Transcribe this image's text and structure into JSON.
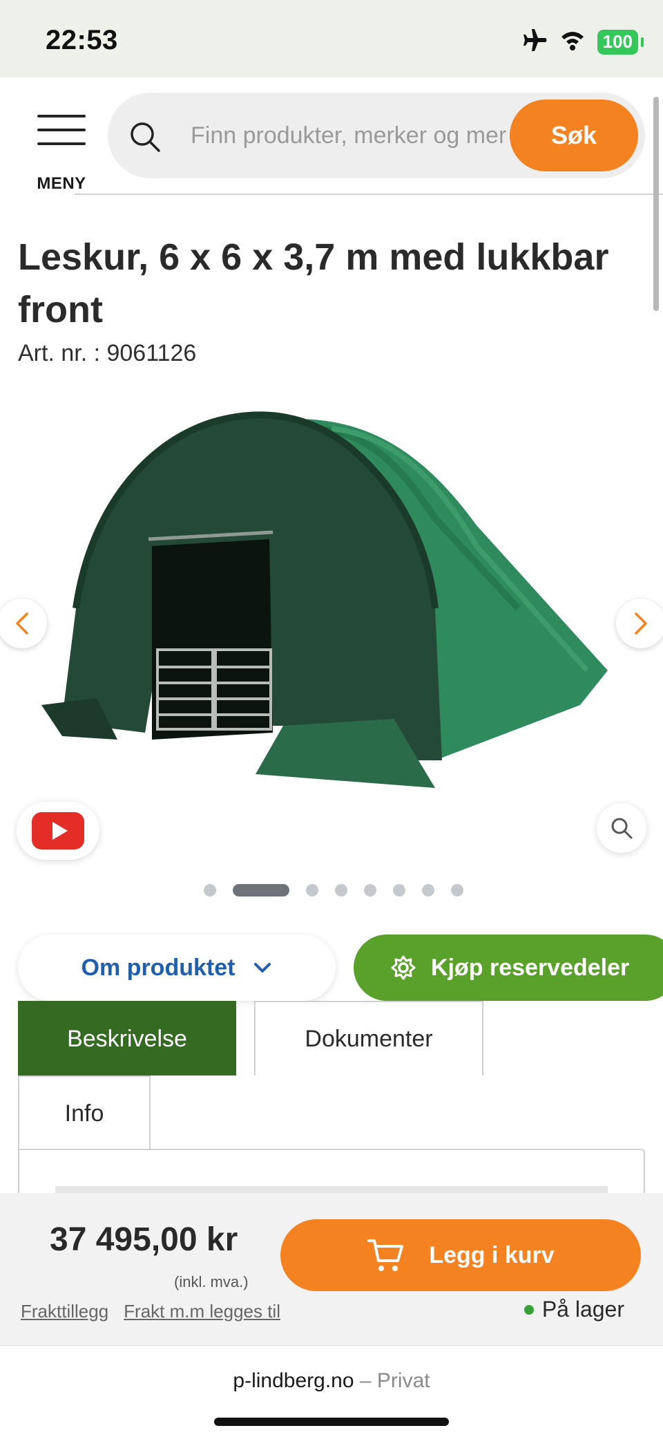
{
  "status": {
    "time": "22:53",
    "battery": "100"
  },
  "header": {
    "menu_label": "MENY",
    "search_placeholder": "Finn produkter, merker og mer",
    "search_button": "Søk"
  },
  "product": {
    "title": "Leskur, 6 x 6 x 3,7 m med lukkbar front",
    "art_nr": "Art. nr. : 9061126"
  },
  "gallery": {
    "total_images": 8,
    "active_index": 1
  },
  "actions": {
    "about": "Om produktet",
    "spare_parts": "Kjøp reservedeler"
  },
  "tabs": [
    {
      "label": "Beskrivelse",
      "active": true
    },
    {
      "label": "Dokumenter",
      "active": false
    },
    {
      "label": "Info",
      "active": false
    }
  ],
  "buy_bar": {
    "price": "37 495,00 kr",
    "vat_note": "(inkl. mva.)",
    "freight_link_1": "Frakttillegg",
    "freight_link_2": "Frakt m.m legges til",
    "add_to_cart": "Legg i kurv",
    "stock_status": "På lager"
  },
  "browser": {
    "domain": "p-lindberg.no",
    "separator": "–",
    "mode": "Privat"
  },
  "colors": {
    "orange": "#f58220",
    "green": "#5aa12b",
    "dark_green": "#356a23",
    "link_blue": "#1f5fae"
  }
}
